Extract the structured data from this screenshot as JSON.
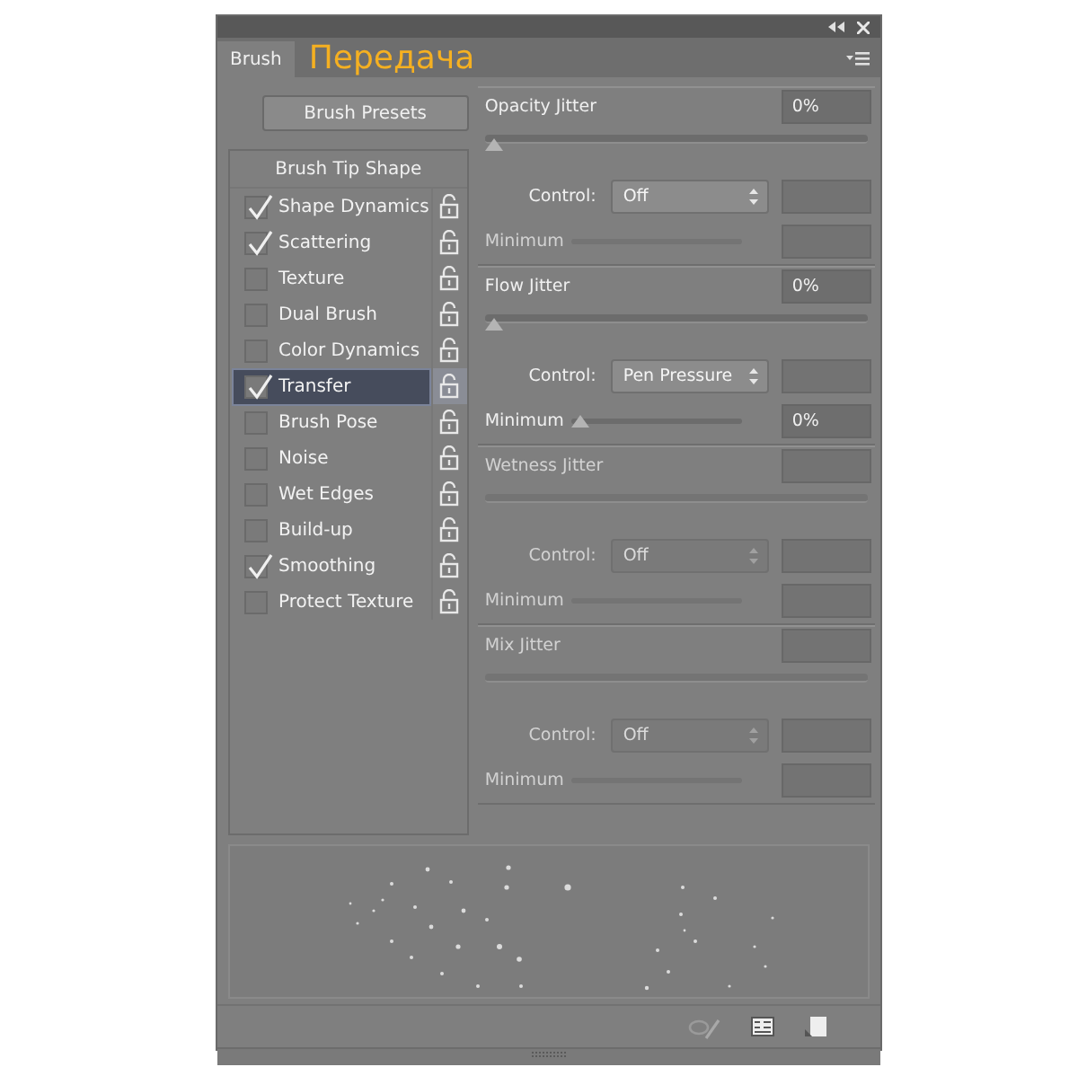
{
  "panel": {
    "tab": "Brush",
    "annotation": "Передача"
  },
  "presets_button": "Brush Presets",
  "tip_shape": "Brush Tip Shape",
  "options": [
    {
      "label": "Shape Dynamics",
      "checked": true,
      "selected": false
    },
    {
      "label": "Scattering",
      "checked": true,
      "selected": false
    },
    {
      "label": "Texture",
      "checked": false,
      "selected": false
    },
    {
      "label": "Dual Brush",
      "checked": false,
      "selected": false
    },
    {
      "label": "Color Dynamics",
      "checked": false,
      "selected": false
    },
    {
      "label": "Transfer",
      "checked": true,
      "selected": true
    },
    {
      "label": "Brush Pose",
      "checked": false,
      "selected": false
    },
    {
      "label": "Noise",
      "checked": false,
      "selected": false
    },
    {
      "label": "Wet Edges",
      "checked": false,
      "selected": false
    },
    {
      "label": "Build-up",
      "checked": false,
      "selected": false
    },
    {
      "label": "Smoothing",
      "checked": true,
      "selected": false
    },
    {
      "label": "Protect Texture",
      "checked": false,
      "selected": false
    }
  ],
  "sections": [
    {
      "title": "Opacity Jitter",
      "value": "0%",
      "disabled": false,
      "level": 0,
      "control_label": "Control:",
      "control_value": "Off",
      "minimum": {
        "label": "Minimum",
        "disabled": true
      }
    },
    {
      "title": "Flow Jitter",
      "value": "0%",
      "disabled": false,
      "level": 0,
      "control_label": "Control:",
      "control_value": "Pen Pressure",
      "minimum": {
        "label": "Minimum",
        "disabled": false,
        "level": 0,
        "value": "0%"
      }
    },
    {
      "title": "Wetness Jitter",
      "disabled": true,
      "control_label": "Control:",
      "control_value": "Off",
      "minimum": {
        "label": "Minimum",
        "disabled": true
      }
    },
    {
      "title": "Mix Jitter",
      "disabled": true,
      "control_label": "Control:",
      "control_value": "Off",
      "minimum": {
        "label": "Minimum",
        "disabled": true
      }
    }
  ]
}
